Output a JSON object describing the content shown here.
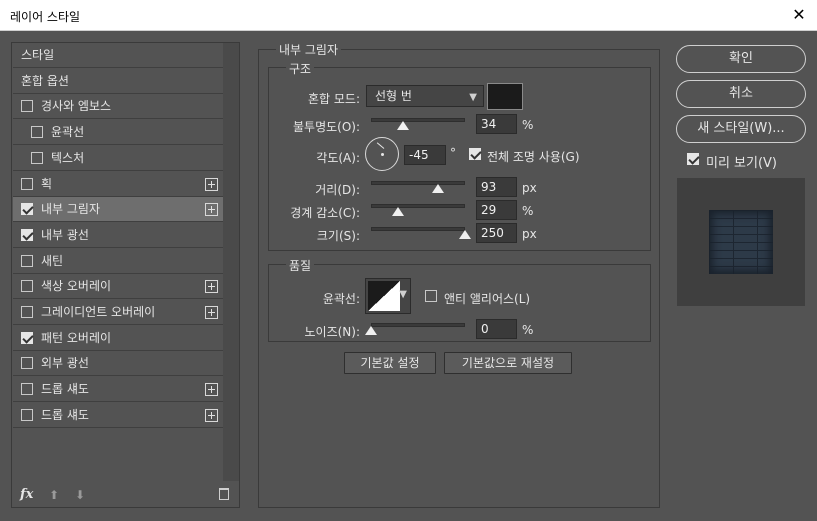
{
  "window": {
    "title": "레이어 스타일",
    "close_glyph": "✕"
  },
  "styles_list": {
    "items": [
      {
        "label": "스타일",
        "checkbox": false,
        "checked": false,
        "plus": false,
        "indent": false,
        "selected": false
      },
      {
        "label": "혼합 옵션",
        "checkbox": false,
        "checked": false,
        "plus": false,
        "indent": false,
        "selected": false
      },
      {
        "label": "경사와 엠보스",
        "checkbox": true,
        "checked": false,
        "plus": false,
        "indent": false,
        "selected": false
      },
      {
        "label": "윤곽선",
        "checkbox": true,
        "checked": false,
        "plus": false,
        "indent": true,
        "selected": false
      },
      {
        "label": "텍스처",
        "checkbox": true,
        "checked": false,
        "plus": false,
        "indent": true,
        "selected": false
      },
      {
        "label": "획",
        "checkbox": true,
        "checked": false,
        "plus": true,
        "indent": false,
        "selected": false
      },
      {
        "label": "내부 그림자",
        "checkbox": true,
        "checked": true,
        "plus": true,
        "indent": false,
        "selected": true
      },
      {
        "label": "내부 광선",
        "checkbox": true,
        "checked": true,
        "plus": false,
        "indent": false,
        "selected": false
      },
      {
        "label": "새틴",
        "checkbox": true,
        "checked": false,
        "plus": false,
        "indent": false,
        "selected": false
      },
      {
        "label": "색상 오버레이",
        "checkbox": true,
        "checked": false,
        "plus": true,
        "indent": false,
        "selected": false
      },
      {
        "label": "그레이디언트 오버레이",
        "checkbox": true,
        "checked": false,
        "plus": true,
        "indent": false,
        "selected": false
      },
      {
        "label": "패턴 오버레이",
        "checkbox": true,
        "checked": true,
        "plus": false,
        "indent": false,
        "selected": false
      },
      {
        "label": "외부 광선",
        "checkbox": true,
        "checked": false,
        "plus": false,
        "indent": false,
        "selected": false
      },
      {
        "label": "드롭 섀도",
        "checkbox": true,
        "checked": false,
        "plus": true,
        "indent": false,
        "selected": false
      },
      {
        "label": "드롭 섀도",
        "checkbox": true,
        "checked": false,
        "plus": true,
        "indent": false,
        "selected": false
      }
    ],
    "bottom": {
      "fx_label": "fx",
      "up_glyph": "⬆",
      "down_glyph": "⬇"
    }
  },
  "inner_shadow": {
    "section_title": "내부 그림자",
    "structure": {
      "title": "구조",
      "blend_mode_label": "혼합 모드:",
      "blend_mode_value": "선형 번",
      "shadow_color": "#1b1b1b",
      "opacity_label": "불투명도(O):",
      "opacity_value": "34",
      "opacity_unit": "%",
      "angle_label": "각도(A):",
      "angle_value": "-45",
      "angle_unit": "°",
      "global_light_label": "전체 조명 사용(G)",
      "global_light_checked": true,
      "distance_label": "거리(D):",
      "distance_value": "93",
      "distance_unit": "px",
      "choke_label": "경계 감소(C):",
      "choke_value": "29",
      "choke_unit": "%",
      "size_label": "크기(S):",
      "size_value": "250",
      "size_unit": "px"
    },
    "quality": {
      "title": "품질",
      "contour_label": "윤곽선:",
      "anti_alias_label": "앤티 앨리어스(L)",
      "anti_alias_checked": false,
      "noise_label": "노이즈(N):",
      "noise_value": "0",
      "noise_unit": "%"
    },
    "make_default_label": "기본값 설정",
    "reset_default_label": "기본값으로 재설정"
  },
  "right": {
    "ok_label": "확인",
    "cancel_label": "취소",
    "new_style_label": "새 스타일(W)...",
    "preview_label": "미리 보기(V)",
    "preview_checked": true
  }
}
